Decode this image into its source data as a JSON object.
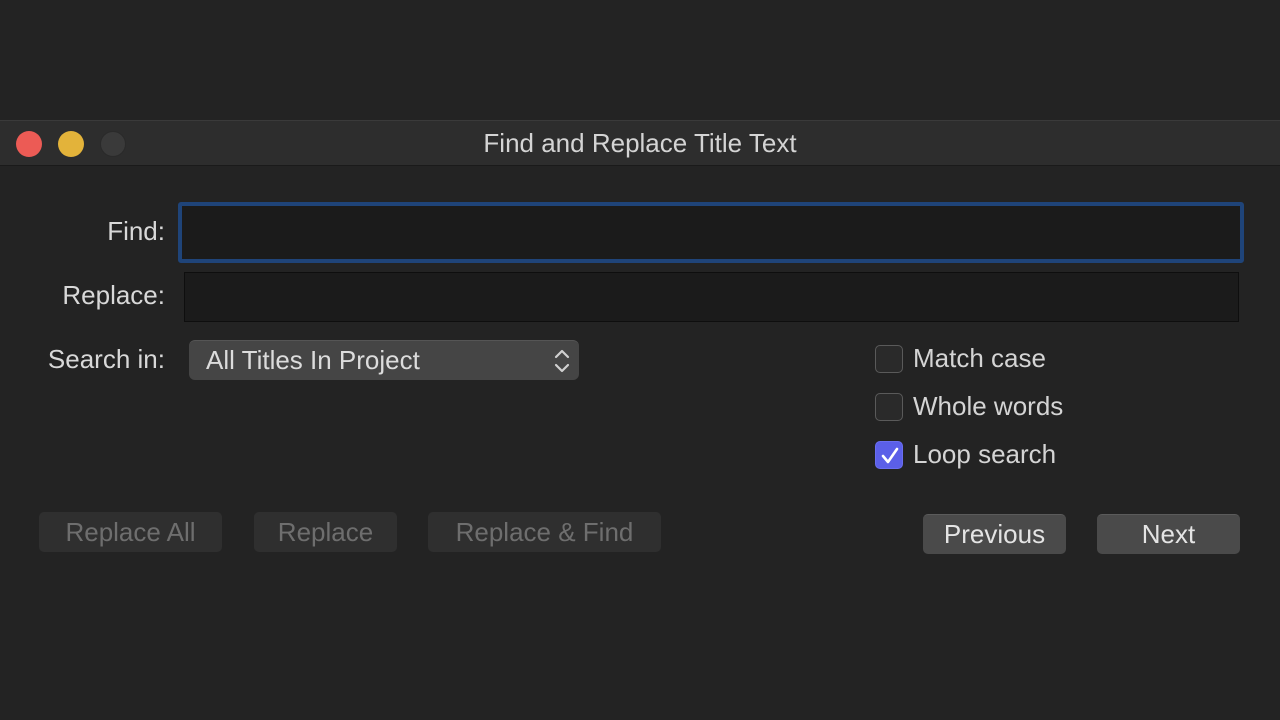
{
  "window": {
    "title": "Find and Replace Title Text"
  },
  "form": {
    "find_label": "Find:",
    "find_value": "",
    "replace_label": "Replace:",
    "replace_value": "",
    "search_in_label": "Search in:",
    "search_in_value": "All Titles In Project"
  },
  "options": {
    "match_case": {
      "label": "Match case",
      "checked": false
    },
    "whole_words": {
      "label": "Whole words",
      "checked": false
    },
    "loop_search": {
      "label": "Loop search",
      "checked": true
    }
  },
  "buttons": {
    "replace_all": "Replace All",
    "replace": "Replace",
    "replace_and_find": "Replace & Find",
    "previous": "Previous",
    "next": "Next"
  },
  "icons": {
    "close": "close-traffic-light",
    "minimize": "minimize-traffic-light",
    "zoom": "zoom-traffic-light",
    "select_arrows": "chevron-up-down-icon",
    "checkmark": "checkmark-icon"
  },
  "colors": {
    "close": "#ec5b55",
    "minimize": "#e3b33a",
    "focus_ring": "#1f4479",
    "checkbox_accent": "#5b5fe8"
  }
}
